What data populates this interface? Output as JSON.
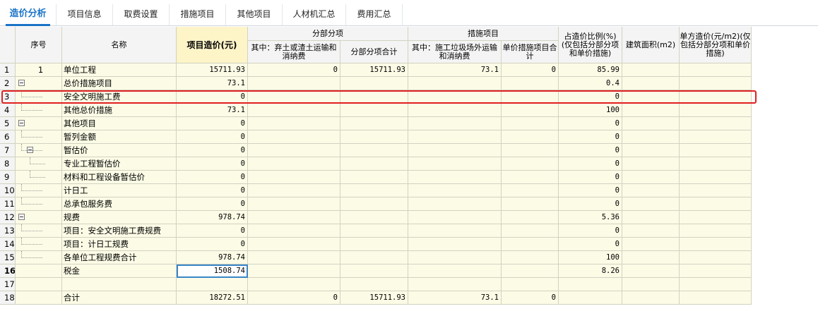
{
  "tabs": [
    "造价分析",
    "项目信息",
    "取费设置",
    "措施项目",
    "其他项目",
    "人材机汇总",
    "费用汇总"
  ],
  "active_tab": 0,
  "headers": {
    "seq": "序号",
    "name": "名称",
    "project_cost": "项目造价(元)",
    "sub_items": "分部分项",
    "sub_items_waste": "其中：弃土或渣土运输和消纳费",
    "sub_items_total": "分部分项合计",
    "measures": "措施项目",
    "measures_waste": "其中：施工垃圾场外运输和消纳费",
    "unit_measures_total": "单价措施项目合计",
    "ratio": "占造价比例(%)(仅包括分部分项和单价措施)",
    "area": "建筑面积(m2)",
    "unit_cost": "单方造价(元/m2)(仅包括分部分项和单价措施)"
  },
  "rows": [
    {
      "idx": "1",
      "seq": "1",
      "name": "单位工程",
      "cost": "15711.93",
      "waste": "0",
      "subtotal": "15711.93",
      "mwaste": "73.1",
      "umt": "0",
      "ratio": "85.99",
      "level": 0,
      "exp": false
    },
    {
      "idx": "2",
      "seq": "",
      "name": "总价措施项目",
      "cost": "73.1",
      "waste": "",
      "subtotal": "",
      "mwaste": "",
      "umt": "",
      "ratio": "0.4",
      "level": 0,
      "exp": true
    },
    {
      "idx": "3",
      "seq": "",
      "name": "安全文明施工费",
      "cost": "0",
      "waste": "",
      "subtotal": "",
      "mwaste": "",
      "umt": "",
      "ratio": "0",
      "level": 1,
      "exp": false
    },
    {
      "idx": "4",
      "seq": "",
      "name": "其他总价措施",
      "cost": "73.1",
      "waste": "",
      "subtotal": "",
      "mwaste": "",
      "umt": "",
      "ratio": "100",
      "level": 1,
      "exp": false
    },
    {
      "idx": "5",
      "seq": "",
      "name": "其他项目",
      "cost": "0",
      "waste": "",
      "subtotal": "",
      "mwaste": "",
      "umt": "",
      "ratio": "0",
      "level": 0,
      "exp": true
    },
    {
      "idx": "6",
      "seq": "",
      "name": "暂列金额",
      "cost": "0",
      "waste": "",
      "subtotal": "",
      "mwaste": "",
      "umt": "",
      "ratio": "0",
      "level": 1,
      "exp": false
    },
    {
      "idx": "7",
      "seq": "",
      "name": "暂估价",
      "cost": "0",
      "waste": "",
      "subtotal": "",
      "mwaste": "",
      "umt": "",
      "ratio": "0",
      "level": 1,
      "exp": true
    },
    {
      "idx": "8",
      "seq": "",
      "name": "专业工程暂估价",
      "cost": "0",
      "waste": "",
      "subtotal": "",
      "mwaste": "",
      "umt": "",
      "ratio": "0",
      "level": 2,
      "exp": false
    },
    {
      "idx": "9",
      "seq": "",
      "name": "材料和工程设备暂估价",
      "cost": "0",
      "waste": "",
      "subtotal": "",
      "mwaste": "",
      "umt": "",
      "ratio": "0",
      "level": 2,
      "exp": false
    },
    {
      "idx": "10",
      "seq": "",
      "name": "计日工",
      "cost": "0",
      "waste": "",
      "subtotal": "",
      "mwaste": "",
      "umt": "",
      "ratio": "0",
      "level": 1,
      "exp": false
    },
    {
      "idx": "11",
      "seq": "",
      "name": "总承包服务费",
      "cost": "0",
      "waste": "",
      "subtotal": "",
      "mwaste": "",
      "umt": "",
      "ratio": "0",
      "level": 1,
      "exp": false
    },
    {
      "idx": "12",
      "seq": "",
      "name": "规费",
      "cost": "978.74",
      "waste": "",
      "subtotal": "",
      "mwaste": "",
      "umt": "",
      "ratio": "5.36",
      "level": 0,
      "exp": true
    },
    {
      "idx": "13",
      "seq": "",
      "name": "项目：安全文明施工费规费",
      "cost": "0",
      "waste": "",
      "subtotal": "",
      "mwaste": "",
      "umt": "",
      "ratio": "0",
      "level": 1,
      "exp": false
    },
    {
      "idx": "14",
      "seq": "",
      "name": "项目：计日工规费",
      "cost": "0",
      "waste": "",
      "subtotal": "",
      "mwaste": "",
      "umt": "",
      "ratio": "0",
      "level": 1,
      "exp": false
    },
    {
      "idx": "15",
      "seq": "",
      "name": "各单位工程规费合计",
      "cost": "978.74",
      "waste": "",
      "subtotal": "",
      "mwaste": "",
      "umt": "",
      "ratio": "100",
      "level": 1,
      "exp": false
    },
    {
      "idx": "16",
      "seq": "",
      "name": "税金",
      "cost": "1508.74",
      "waste": "",
      "subtotal": "",
      "mwaste": "",
      "umt": "",
      "ratio": "8.26",
      "level": 0,
      "exp": false
    },
    {
      "idx": "17",
      "seq": "",
      "name": "",
      "cost": "",
      "waste": "",
      "subtotal": "",
      "mwaste": "",
      "umt": "",
      "ratio": "",
      "level": 0,
      "exp": false
    },
    {
      "idx": "18",
      "seq": "",
      "name": "合计",
      "cost": "18272.51",
      "waste": "0",
      "subtotal": "15711.93",
      "mwaste": "73.1",
      "umt": "0",
      "ratio": "",
      "level": 0,
      "exp": false
    }
  ],
  "selected_row": 15,
  "highlighted_row": 2
}
